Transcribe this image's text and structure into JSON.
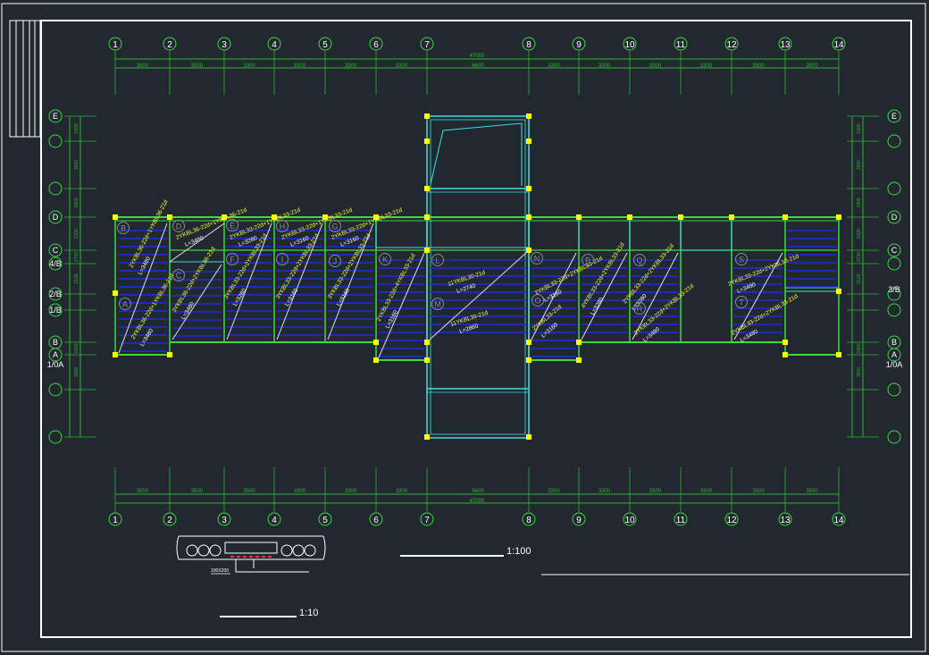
{
  "canvas": {
    "background": "#212830"
  },
  "colors": {
    "frame": "#ffffff",
    "dim": "#2fb52f",
    "wall": "#3dd93d",
    "cyan": "#3fe0e0",
    "slab": "#1b2de0",
    "label": "#ffff33",
    "bubble": "#8a8a8a",
    "column": "#ffff00"
  },
  "axes": {
    "top_numbers": [
      "1",
      "2",
      "3",
      "4",
      "5",
      "6",
      "7",
      "8",
      "9",
      "10",
      "11",
      "12",
      "13",
      "14"
    ],
    "bottom_numbers": [
      "1",
      "2",
      "3",
      "4",
      "5",
      "6",
      "7",
      "8",
      "9",
      "10",
      "11",
      "12",
      "13",
      "14"
    ],
    "top_spacings": [
      "3500",
      "3500",
      "3300",
      "3300",
      "3300",
      "3300",
      "6600",
      "3300",
      "3300",
      "3300",
      "3300",
      "3500",
      "3500"
    ],
    "bottom_spacings": [
      "3500",
      "3500",
      "3500",
      "3300",
      "3300",
      "3300",
      "6600",
      "3300",
      "3300",
      "3300",
      "3300",
      "3500",
      "3500"
    ],
    "top_total": "47000",
    "bottom_total": "47000",
    "left_rows": [
      "E",
      "D",
      "C",
      "4/B",
      "2/B",
      "1/B",
      "B",
      "A",
      "1/0A"
    ],
    "right_rows": [
      "E",
      "D",
      "C",
      "3/B",
      "B",
      "A",
      "1/0A"
    ],
    "side_spacings": [
      "1800",
      "3600",
      "1800",
      "2100",
      "2700",
      "2100",
      "1800",
      "3600"
    ]
  },
  "slab_labels": [
    {
      "id": "B",
      "type": "2YKBL36-22d+1YKBL36-21d",
      "length": "L=3480"
    },
    {
      "id": "A",
      "type": "2YKBL36-22d+1YKBL36-21d",
      "length": "L=3480"
    },
    {
      "id": "D",
      "type": "2YKBL36-22d+1YKBL36-21d",
      "length": "L=3480"
    },
    {
      "id": "C",
      "type": "3YKBL36-22d+2YKBL36-21d",
      "length": "L=3480"
    },
    {
      "id": "E",
      "type": "2YKBL33-22d+1YKBL33-21d",
      "length": "L=3280"
    },
    {
      "id": "F",
      "type": "3YKBL33-22d+2YKBL33-21d",
      "length": "L=3280"
    },
    {
      "id": "H",
      "type": "2YKBL33-22d+1YKBL33-21d",
      "length": "L=3160"
    },
    {
      "id": "I",
      "type": "3YKBL33-22d+2YKBL33-21d",
      "length": "L=3160"
    },
    {
      "id": "G",
      "type": "2YKBL33-22d+1YKBL33-21d",
      "length": "L=3160"
    },
    {
      "id": "J",
      "type": "3YKBL33-22d+2YKBL33-21d",
      "length": "L=3160"
    },
    {
      "id": "K",
      "type": "2YKBL33-22d+4YKBL33-21d",
      "length": "L=3160"
    },
    {
      "id": "L",
      "type": "11YKBL30-21d",
      "length": "L=2740"
    },
    {
      "id": "M",
      "type": "11YKBL30-21d",
      "length": "L=2860"
    },
    {
      "id": "N",
      "type": "2YKBL33-22d+2YKBL33-21d",
      "length": "L=3160"
    },
    {
      "id": "O",
      "type": "2YKBL33-21d",
      "length": "L=3160"
    },
    {
      "id": "P",
      "type": "4YKBL33-22d+2YKBL33-21d",
      "length": "L=3280"
    },
    {
      "id": "Q",
      "type": "2YKBL33-22d+2YKBL33-21d",
      "length": "L=3280"
    },
    {
      "id": "R",
      "type": "2YKBL33-22d+2YKBL33-21d",
      "length": "L=3480"
    },
    {
      "id": "S",
      "type": "2YKBL33-22d+2YKBL33-21d",
      "length": "L=3480"
    },
    {
      "id": "T",
      "type": "2YKBL33-22d+2YKBL33-21d",
      "length": "L=3480"
    }
  ],
  "scales": {
    "plan": "1:100",
    "detail": "1:10"
  },
  "detail": {
    "note": "100X200"
  }
}
